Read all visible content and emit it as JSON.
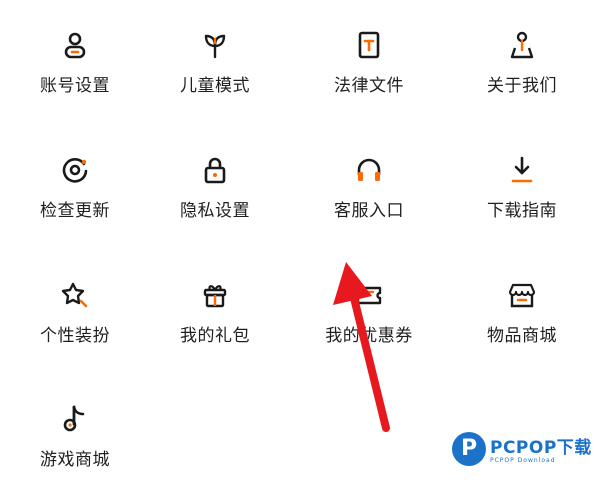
{
  "accent_color": "#ff6a00",
  "icon_color": "#1a1a1a",
  "arrow_color": "#e8181f",
  "menu": {
    "items": [
      {
        "label": "账号设置",
        "icon": "account-settings-icon"
      },
      {
        "label": "儿童模式",
        "icon": "child-mode-icon"
      },
      {
        "label": "法律文件",
        "icon": "legal-document-icon"
      },
      {
        "label": "关于我们",
        "icon": "about-us-icon"
      },
      {
        "label": "检查更新",
        "icon": "check-update-icon"
      },
      {
        "label": "隐私设置",
        "icon": "privacy-lock-icon"
      },
      {
        "label": "客服入口",
        "icon": "customer-service-headphones-icon"
      },
      {
        "label": "下载指南",
        "icon": "download-guide-icon"
      },
      {
        "label": "个性装扮",
        "icon": "personalize-star-icon"
      },
      {
        "label": "我的礼包",
        "icon": "gift-pack-icon"
      },
      {
        "label": "我的优惠券",
        "icon": "coupon-ticket-icon"
      },
      {
        "label": "物品商城",
        "icon": "shop-store-icon"
      },
      {
        "label": "游戏商城",
        "icon": "game-mall-music-note-icon"
      }
    ]
  },
  "watermark": {
    "logo_letter": "P",
    "brand": "PCPOP下载",
    "sub": "PCPOP Download"
  }
}
